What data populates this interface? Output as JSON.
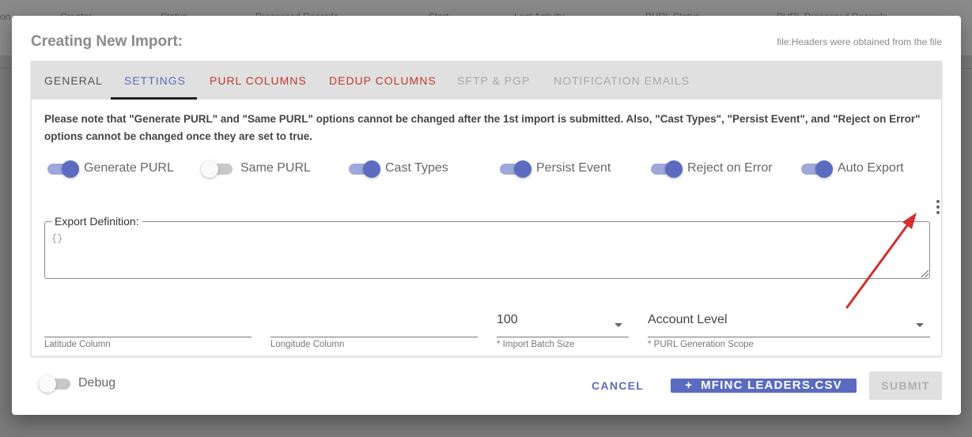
{
  "background": {
    "columns": [
      "on",
      "Creator",
      "Status",
      "Processed Records",
      "Start",
      "Last Activity",
      "PURL Status",
      "PURL Processed Records"
    ]
  },
  "modal": {
    "title": "Creating New Import:",
    "note": "file:Headers were obtained from the file"
  },
  "tabs": [
    {
      "label": "General",
      "state": "default"
    },
    {
      "label": "Settings",
      "state": "active"
    },
    {
      "label": "PURL Columns",
      "state": "error"
    },
    {
      "label": "Dedup Columns",
      "state": "error"
    },
    {
      "label": "SFTP & PGP",
      "state": "disabled"
    },
    {
      "label": "Notification Emails",
      "state": "disabled"
    }
  ],
  "notice": "Please note that \"Generate PURL\" and \"Same PURL\" options cannot be changed after the 1st import is submitted. Also, \"Cast Types\", \"Persist Event\", and \"Reject on Error\" options cannot be changed once they are set to true.",
  "toggles": [
    {
      "label": "Generate PURL",
      "on": true
    },
    {
      "label": "Same PURL",
      "on": false
    },
    {
      "label": "Cast Types",
      "on": true
    },
    {
      "label": "Persist Event",
      "on": true
    },
    {
      "label": "Reject on Error",
      "on": true
    },
    {
      "label": "Auto Export",
      "on": true
    }
  ],
  "export_definition": {
    "label": "Export Definition:",
    "value": "{}"
  },
  "fields": {
    "latitude": {
      "value": "",
      "hint": "Latitude Column"
    },
    "longitude": {
      "value": "",
      "hint": "Longitude Column"
    },
    "batch_size": {
      "value": "100",
      "hint": "* Import Batch Size"
    },
    "purl_scope": {
      "value": "Account Level",
      "hint": "* PURL Generation Scope"
    }
  },
  "debug": {
    "label": "Debug",
    "on": false
  },
  "buttons": {
    "cancel": "CANCEL",
    "file_icon": "+",
    "file": "MFINC LEADERS.CSV",
    "submit": "SUBMIT"
  },
  "colors": {
    "accent": "#5c6bc0",
    "error": "#c0392b",
    "annotation_arrow": "#d32f2f"
  }
}
